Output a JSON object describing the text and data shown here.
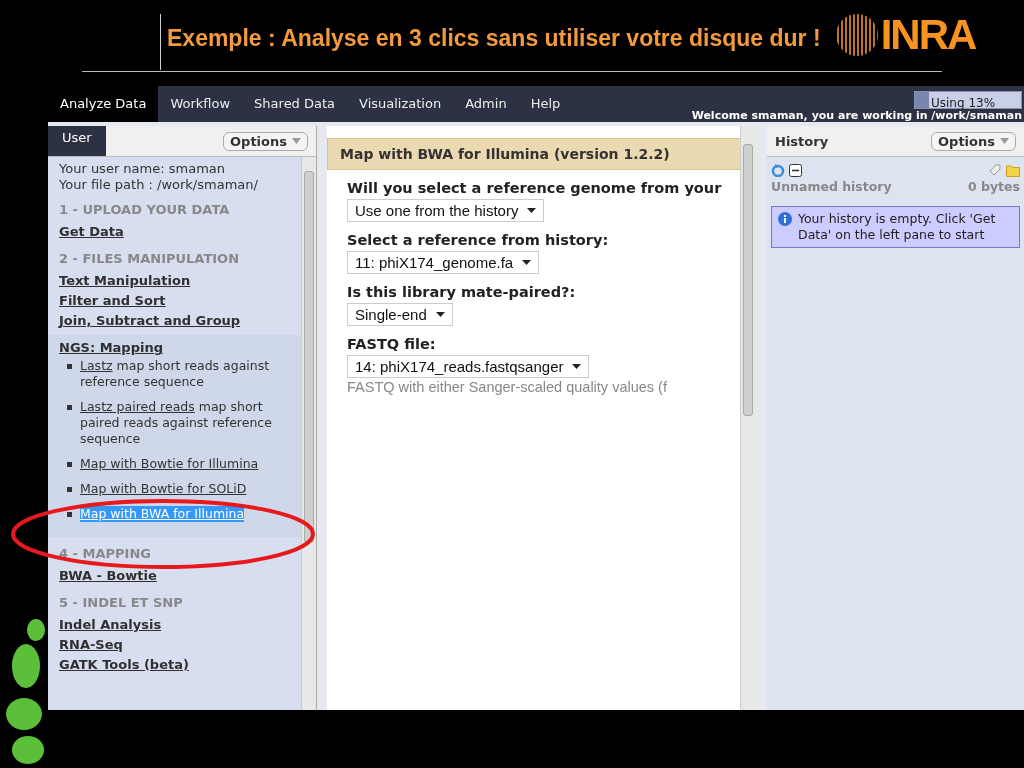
{
  "slide": {
    "title": "Exemple : Analyse en 3 clics sans utiliser votre disque dur !",
    "logo_text": "INRA"
  },
  "nav": {
    "tabs": [
      {
        "label": "Analyze Data",
        "selected": true
      },
      {
        "label": "Workflow",
        "selected": false
      },
      {
        "label": "Shared Data",
        "selected": false
      },
      {
        "label": "Visualization",
        "selected": false
      },
      {
        "label": "Admin",
        "selected": false
      },
      {
        "label": "Help",
        "selected": false
      }
    ],
    "usage": {
      "label": "Using 13%",
      "level": 0.13
    },
    "welcome": "Welcome smaman, you are working in /work/smaman"
  },
  "tool_panel": {
    "tab": "User",
    "options": "Options",
    "user_info": [
      "Your user name: smaman",
      "Your file path : /work/smaman/"
    ],
    "sections": [
      {
        "kind": "heading",
        "text": "1 - UPLOAD YOUR DATA"
      },
      {
        "kind": "link",
        "text": "Get Data"
      },
      {
        "kind": "heading",
        "text": "2 - FILES MANIPULATION"
      },
      {
        "kind": "link",
        "text": "Text Manipulation"
      },
      {
        "kind": "link",
        "text": "Filter and Sort"
      },
      {
        "kind": "link",
        "text": "Join, Subtract and Group"
      },
      {
        "kind": "group",
        "text": "NGS: Mapping",
        "tools": [
          {
            "link": "Lastz",
            "rest": "map short reads against reference sequence",
            "selected": false
          },
          {
            "link": "Lastz paired reads",
            "rest": "map short paired reads against reference sequence",
            "selected": false
          },
          {
            "link": "Map with Bowtie for Illumina",
            "selected": false
          },
          {
            "link": "Map with Bowtie for SOLiD",
            "selected": false
          },
          {
            "link": "Map with BWA for Illumina",
            "selected": true
          }
        ]
      },
      {
        "kind": "heading",
        "text": "4 - MAPPING"
      },
      {
        "kind": "link",
        "text": "BWA - Bowtie"
      },
      {
        "kind": "heading",
        "text": "5 - INDEL ET SNP"
      },
      {
        "kind": "link",
        "text": "Indel Analysis"
      },
      {
        "kind": "link",
        "text": "RNA-Seq"
      },
      {
        "kind": "link",
        "text": "GATK Tools (beta)"
      }
    ]
  },
  "tool_form": {
    "title": "Map with BWA for Illumina (version 1.2.2)",
    "fields": [
      {
        "label": "Will you select a reference genome from your",
        "value": "Use one from the history"
      },
      {
        "label": "Select a reference from history:",
        "value": "11: phiX174_genome.fa"
      },
      {
        "label": "Is this library mate-paired?:",
        "value": "Single-end"
      },
      {
        "label": "FASTQ file:",
        "value": "14: phiX174_reads.fastqsanger",
        "help": "FASTQ with either Sanger-scaled quality values (f"
      }
    ]
  },
  "history": {
    "title": "History",
    "options": "Options",
    "name": "Unnamed history",
    "size": "0 bytes",
    "message": "Your history is empty. Click 'Get Data' on the left pane to start"
  }
}
